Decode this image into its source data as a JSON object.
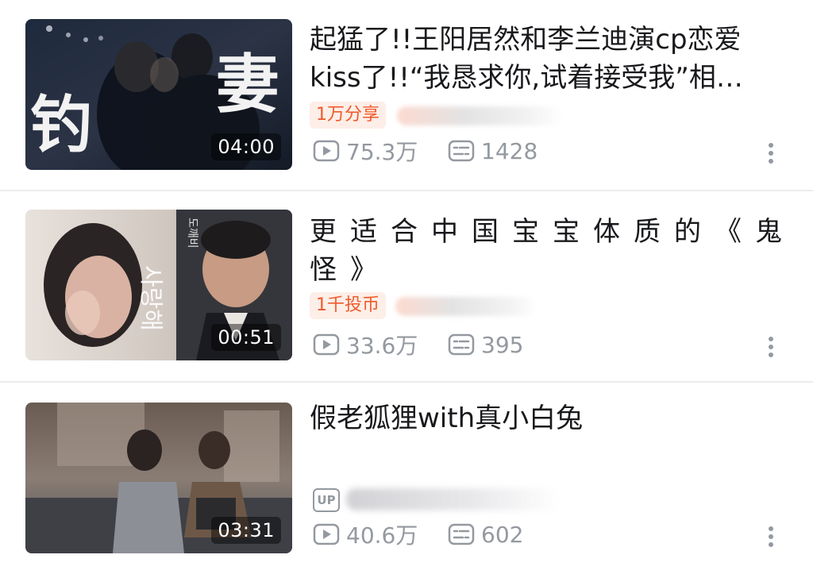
{
  "videos": [
    {
      "title_line1": "起猛了!!王阳居然和李兰迪演cp恋爱",
      "title_line2": "kiss了!!“我恳求你,试着接受我”相…",
      "duration": "04:00",
      "badge": "1万分享",
      "views": "75.3万",
      "danmaku": "1428",
      "thumb_overlay": [
        "钓",
        "妻"
      ]
    },
    {
      "title": "更适合中国宝宝体质的《鬼怪》",
      "duration": "00:51",
      "badge": "1千投币",
      "views": "33.6万",
      "danmaku": "395",
      "thumb_overlay": [
        "사랑해",
        "도깨비"
      ]
    },
    {
      "title": "假老狐狸with真小白兔",
      "duration": "03:31",
      "up_label": "UP",
      "views": "40.6万",
      "danmaku": "602"
    }
  ],
  "icons": {
    "views": "play-count-icon",
    "danmaku": "danmaku-count-icon",
    "more": "more-vertical-icon"
  },
  "colors": {
    "badge_text": "#f05a2a",
    "badge_bg": "#fdeee8",
    "meta_text": "#9499a0",
    "title_text": "#18191c",
    "divider": "#ececec"
  }
}
